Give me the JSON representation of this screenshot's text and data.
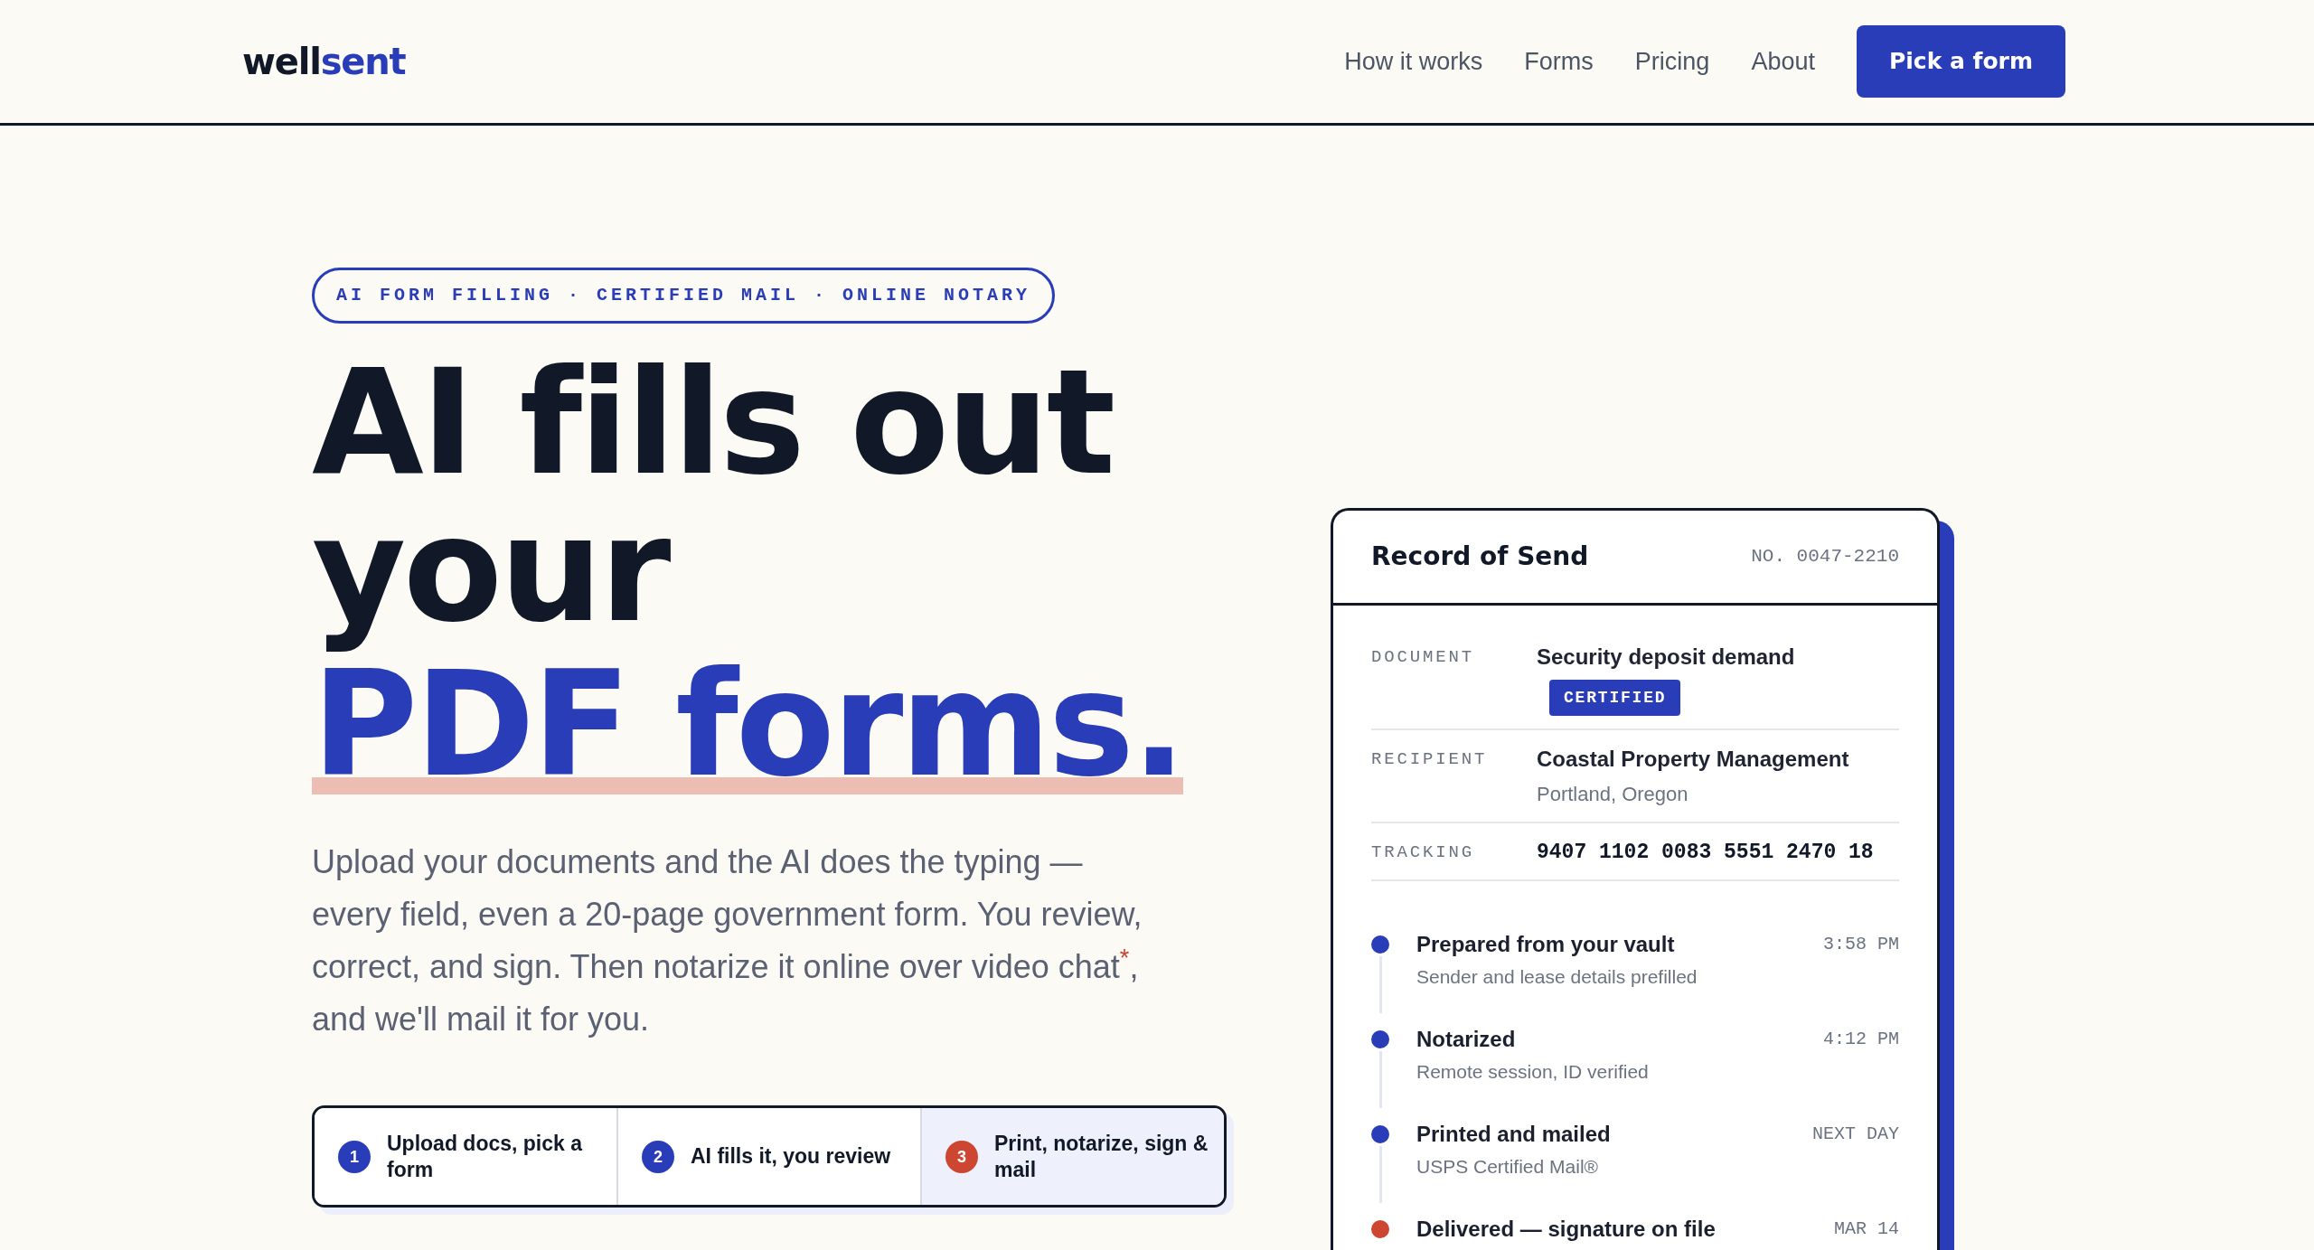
{
  "header": {
    "logo": {
      "primary": "well",
      "accent": "sent"
    },
    "nav": [
      "How it works",
      "Forms",
      "Pricing",
      "About"
    ],
    "cta": "Pick a form"
  },
  "hero": {
    "eyebrow": "AI FORM FILLING · CERTIFIED MAIL · ONLINE NOTARY",
    "headline": "AI fills out your",
    "headline_accent": "PDF forms.",
    "description": "Upload your documents and the AI does the typing — every field, even a 20-page government form. You review, correct, and sign. Then notarize it online over video chat$^{*}$, and we'll mail it for you.",
    "steps": [
      {
        "number": "1",
        "label": "Upload docs, pick a form",
        "active": false
      },
      {
        "number": "2",
        "label": "AI fills it, you review",
        "active": false
      },
      {
        "number": "3",
        "label": "Print, notarize, sign & mail",
        "active": true
      }
    ]
  },
  "record": {
    "title": "Record of Send",
    "number": "NO. 0047-2210",
    "fields": [
      {
        "kind": "text",
        "label": "DOCUMENT",
        "value": "Security deposit demand",
        "badge": "CERTIFIED"
      },
      {
        "kind": "text",
        "label": "RECIPIENT",
        "value": "Coastal Property Management",
        "detail": "Portland, Oregon"
      },
      {
        "kind": "code",
        "label": "TRACKING",
        "value": "9407 1102 0083 5551 2470 18"
      }
    ],
    "events": [
      {
        "title": "Prepared from your vault",
        "detail": "Sender and lease details prefilled",
        "time": "3:58 PM",
        "color": "#2a3db8"
      },
      {
        "title": "Notarized",
        "detail": "Remote session, ID verified",
        "time": "4:12 PM",
        "color": "#2a3db8"
      },
      {
        "title": "Printed and mailed",
        "detail": "USPS Certified Mail®",
        "time": "NEXT DAY",
        "color": "#2a3db8"
      },
      {
        "title": "Delivered — signature on file",
        "time": "MAR 14",
        "color": "#cd4631"
      }
    ]
  }
}
